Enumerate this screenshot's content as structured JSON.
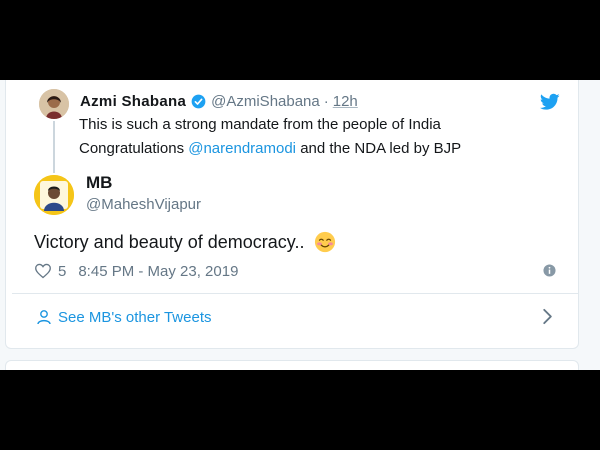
{
  "quoted_tweet": {
    "author_name": "Azmi Shabana",
    "handle": "@AzmiShabana",
    "separator": "·",
    "time": "12h",
    "text_line1": "This is such a strong mandate from the people of India",
    "text_line2_prefix": "Congratulations ",
    "mention": "@narendramodi",
    "text_line2_suffix": " and the NDA led by BJP"
  },
  "tweet": {
    "author_name": "MB",
    "handle": "@MaheshVijapur",
    "text": "Victory and beauty of democracy..",
    "emoji_icon": "smiling-blushing-face-icon",
    "likes": "5",
    "timestamp": "8:45 PM - May 23, 2019"
  },
  "footer": {
    "see_more_label": "See MB's other Tweets"
  },
  "colors": {
    "link": "#1b95e0",
    "muted": "#657786",
    "text": "#14171a",
    "border": "#e1e8ed"
  }
}
